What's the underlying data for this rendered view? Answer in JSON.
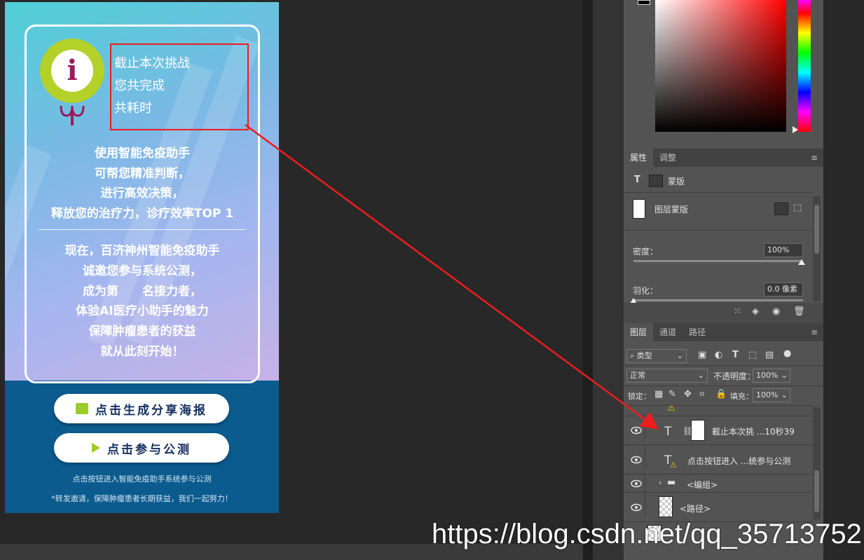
{
  "poster": {
    "header_lines": [
      "截止本次挑战",
      "您共完成",
      "共耗时"
    ],
    "intro_lines": [
      "使用智能免疫助手",
      "可帮您精准判断，",
      "进行高效决策，",
      "释放您的治疗力，诊疗效率TOP 1"
    ],
    "body_lines": [
      "现在，百济神州智能免疫助手",
      "诚邀您参与系统公测，",
      "成为第　　名接力者，",
      "体验AI医疗小助手的魅力",
      "保障肿瘤患者的获益",
      "就从此刻开始！"
    ],
    "button_share": "点击生成分享海报",
    "button_test": "点击参与公测",
    "note1": "点击按钮进入智能免疫助手系统参与公测",
    "note2": "*转发邀请，保障肿瘤患者长期获益，我们一起努力！"
  },
  "properties_panel": {
    "tabs": [
      "属性",
      "调整"
    ],
    "mask_label": "蒙版",
    "layer_mask_label": "图层蒙版",
    "density_label": "密度：",
    "density_value": "100%",
    "feather_label": "羽化：",
    "feather_value": "0.0 像素"
  },
  "layers_panel": {
    "tabs": [
      "图层",
      "通道",
      "路径"
    ],
    "filter_label": "类型",
    "blend_mode": "正常",
    "opacity_label": "不透明度：",
    "opacity_value": "100%",
    "lock_label": "锁定：",
    "fill_label": "填充：",
    "fill_value": "100%",
    "layers": [
      {
        "name": "截止本次挑 ...10秒39",
        "type": "text-mask"
      },
      {
        "name": "点击按钮进入 ...统参与公测",
        "type": "text-warning"
      },
      {
        "name": "<编组>",
        "type": "group"
      },
      {
        "name": "<路径>",
        "type": "path"
      }
    ]
  },
  "watermark": "https://blog.csdn.net/qq_35713752",
  "colors": {
    "annotation_red": "#ee1c1c",
    "panel_bg": "#535353",
    "workspace_bg": "#282828"
  }
}
